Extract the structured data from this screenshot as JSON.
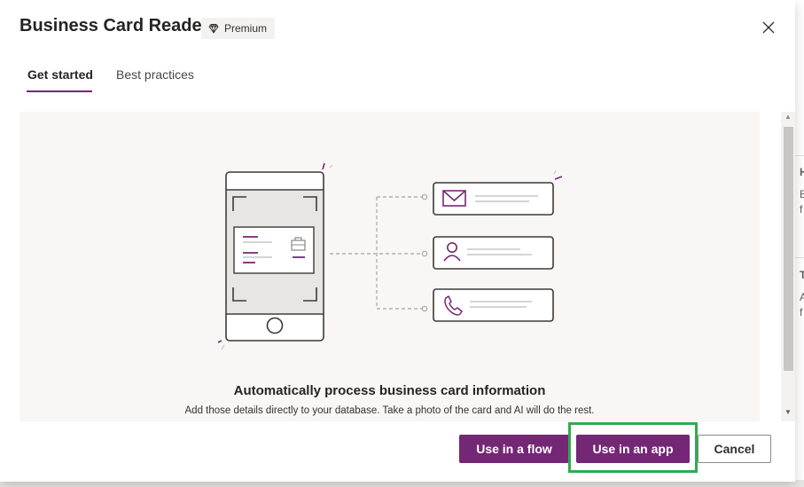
{
  "dialog": {
    "title": "Business Card Reader",
    "badge": "Premium",
    "close_icon": "close-icon"
  },
  "tabs": [
    {
      "label": "Get started",
      "active": true
    },
    {
      "label": "Best practices",
      "active": false
    }
  ],
  "content": {
    "headline": "Automatically process business card information",
    "subtext": "Add those details directly to your database. Take a photo of the card and AI will do the rest."
  },
  "actions": {
    "flow_label": "Use in a flow",
    "app_label": "Use in an app",
    "cancel_label": "Cancel"
  },
  "background_peek": {
    "letters": [
      "H",
      "E",
      "f",
      "T",
      "A",
      "f"
    ]
  },
  "colors": {
    "accent": "#742774",
    "highlight": "#2eac4f"
  }
}
